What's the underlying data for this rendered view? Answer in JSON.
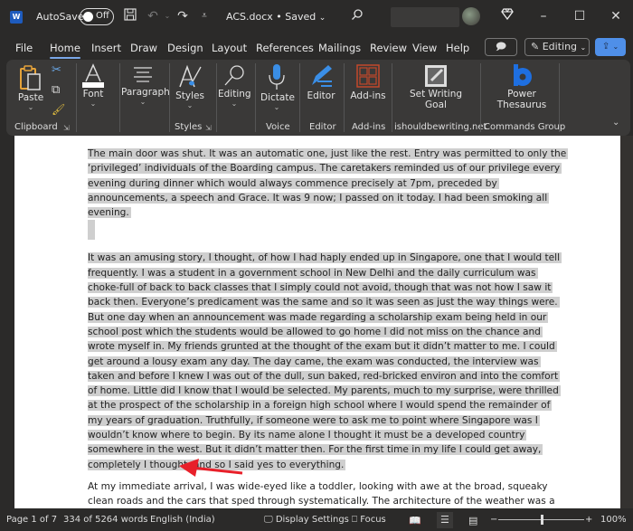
{
  "titlebar": {
    "app_icon": "W",
    "autosave_label": "AutoSave",
    "autosave_state": "Off",
    "document_title": "ACS.docx • Saved",
    "save_icon": "save-icon",
    "undo_icon": "undo-icon",
    "redo_icon": "redo-icon",
    "customize_icon": "customize-toolbar-icon",
    "search_icon": "search-icon",
    "premium_icon": "diamond-icon",
    "minimize": "–",
    "maximize": "☐",
    "close": "✕"
  },
  "menu": {
    "tabs": [
      "File",
      "Home",
      "Insert",
      "Draw",
      "Design",
      "Layout",
      "References",
      "Mailings",
      "Review",
      "View",
      "Help"
    ],
    "active_tab": "Home",
    "comments_icon": "comment-icon",
    "editing_label": "Editing",
    "share_icon": "share-icon"
  },
  "ribbon": {
    "groups": [
      {
        "name": "Clipboard",
        "buttons": [
          "Paste"
        ],
        "small_buttons": [
          "Cut",
          "Copy",
          "Format Painter"
        ]
      },
      {
        "name": "",
        "buttons": [
          "Font"
        ]
      },
      {
        "name": "",
        "buttons": [
          "Paragraph"
        ]
      },
      {
        "name": "Styles",
        "buttons": [
          "Styles"
        ]
      },
      {
        "name": "",
        "buttons": [
          "Editing"
        ]
      },
      {
        "name": "Voice",
        "buttons": [
          "Dictate"
        ]
      },
      {
        "name": "Editor",
        "buttons": [
          "Editor"
        ]
      },
      {
        "name": "Add-ins",
        "buttons": [
          "Add-ins"
        ]
      },
      {
        "name": "ishouldbewriting.net",
        "buttons": [
          "Set Writing Goal"
        ]
      },
      {
        "name": "Commands Group",
        "buttons": [
          "Power Thesaurus"
        ]
      }
    ],
    "labels": {
      "paste": "Paste",
      "clipboard": "Clipboard",
      "font": "Font",
      "paragraph": "Paragraph",
      "styles": "Styles",
      "styles_group": "Styles",
      "editing": "Editing",
      "dictate": "Dictate",
      "voice": "Voice",
      "editor": "Editor",
      "editor_group": "Editor",
      "addins": "Add-ins",
      "addins_group": "Add-ins",
      "set_writing_goal_1": "Set Writing",
      "set_writing_goal_2": "Goal",
      "ishouldbewriting": "ishouldbewriting.net",
      "power_thesaurus_1": "Power",
      "power_thesaurus_2": "Thesaurus",
      "commands_group": "Commands Group"
    }
  },
  "document": {
    "paragraphs": [
      {
        "text": "The main door was shut. It was an automatic one, just like the rest. Entry was permitted to only the ‘privileged’ individuals of the Boarding campus. The caretakers reminded us of our privilege every evening during dinner which would always commence precisely at 7pm, preceded by announcements, a speech and Grace. It was 9 now; I passed on it today. I had been smoking all evening.",
        "selected": true
      },
      {
        "text": "It was an amusing story, I thought, of how I had haply ended up in Singapore, one that I would tell frequently. I was a student in a government school in New Delhi and the daily curriculum was choke-full of back to back classes that I simply could not avoid, though that was not how I saw it back then. Everyone’s predicament was the same and so it was seen as just the way things were. But one day when an announcement was made regarding a scholarship exam being held in our school post which the students would be allowed to go home I did not miss on the chance and wrote myself in. My friends grunted at the thought of the exam but it didn’t matter to me. I could get around a lousy exam any day. The day came, the exam was conducted, the interview was taken and before I knew I was out of the dull, sun baked, red-bricked environ and into the comfort of home. Little did I know that I would be selected. My parents, much to my surprise, were thrilled at the prospect of the scholarship in a foreign high school where I would spend the remainder of my years of graduation. Truthfully, if someone were to ask me to point where Singapore was I wouldn’t know where to begin. By its name alone I thought it must be a developed country somewhere in the west. But it didn’t matter then. For the first time in my life I could get away, completely I thought, and so I said yes to everything.",
        "selected": true
      },
      {
        "text": "At my immediate arrival, I was wide-eyed like a toddler, looking with awe at the broad, squeaky clean roads and the cars that sped through systematically. The architecture of the weather was a",
        "selected": false
      }
    ],
    "annotation": "red-arrow"
  },
  "statusbar": {
    "page": "Page 1 of 7",
    "words": "334 of 5264 words",
    "language": "English (India)",
    "display_settings": "Display Settings",
    "focus": "Focus",
    "zoom_minus": "−",
    "zoom_plus": "+",
    "zoom_level": "100%",
    "zoom_fraction": 0.5
  },
  "colors": {
    "chrome": "#2b2a29",
    "ribbon": "#3a3938",
    "accent": "#4f8fe8",
    "selection": "#cfcfcf",
    "arrow": "#e8202a"
  }
}
